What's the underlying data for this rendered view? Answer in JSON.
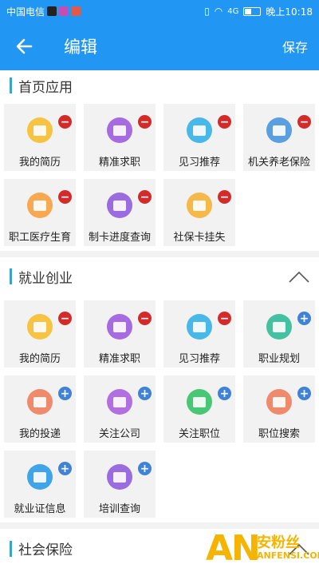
{
  "status_bar": {
    "carrier": "中国电信",
    "network": "4G",
    "time": "晚上10:18"
  },
  "header": {
    "title": "编辑",
    "save_label": "保存"
  },
  "sections": [
    {
      "title": "首页应用",
      "items": [
        {
          "label": "我的简历",
          "icon": "resume-icon",
          "color": "#f6c343",
          "action": "remove"
        },
        {
          "label": "精准求职",
          "icon": "briefcase-icon",
          "color": "#a66be0",
          "action": "remove"
        },
        {
          "label": "见习推荐",
          "icon": "hand-icon",
          "color": "#48b8e8",
          "action": "remove"
        },
        {
          "label": "机关养老保险",
          "icon": "building-icon",
          "color": "#5a9fe0",
          "action": "remove"
        },
        {
          "label": "职工医疗生育",
          "icon": "card-icon",
          "color": "#f7a850",
          "action": "remove"
        },
        {
          "label": "制卡进度查询",
          "icon": "clock-icon",
          "color": "#9b6be0",
          "action": "remove"
        },
        {
          "label": "社保卡挂失",
          "icon": "card-icon",
          "color": "#f7b84a",
          "action": "remove"
        }
      ]
    },
    {
      "title": "就业创业",
      "items": [
        {
          "label": "我的简历",
          "icon": "resume-icon",
          "color": "#f6c343",
          "action": "remove"
        },
        {
          "label": "精准求职",
          "icon": "briefcase-icon",
          "color": "#a66be0",
          "action": "remove"
        },
        {
          "label": "见习推荐",
          "icon": "hand-icon",
          "color": "#48b8e8",
          "action": "remove"
        },
        {
          "label": "职业规划",
          "icon": "tools-icon",
          "color": "#44c1a0",
          "action": "add"
        },
        {
          "label": "我的投递",
          "icon": "send-icon",
          "color": "#f08a6c",
          "action": "add"
        },
        {
          "label": "关注公司",
          "icon": "heart-icon",
          "color": "#b26fe0",
          "action": "add"
        },
        {
          "label": "关注职位",
          "icon": "heart-icon",
          "color": "#48c774",
          "action": "add"
        },
        {
          "label": "职位搜索",
          "icon": "monitor-icon",
          "color": "#f08a6c",
          "action": "add"
        },
        {
          "label": "就业证信息",
          "icon": "id-card-icon",
          "color": "#3fa4e8",
          "action": "add"
        },
        {
          "label": "培训查询",
          "icon": "training-icon",
          "color": "#9b6be0",
          "action": "add"
        }
      ]
    },
    {
      "title": "社会保险",
      "items": []
    }
  ],
  "watermark": {
    "logo": "AN",
    "name": "安粉丝",
    "url": "ANFENSI.COM"
  }
}
